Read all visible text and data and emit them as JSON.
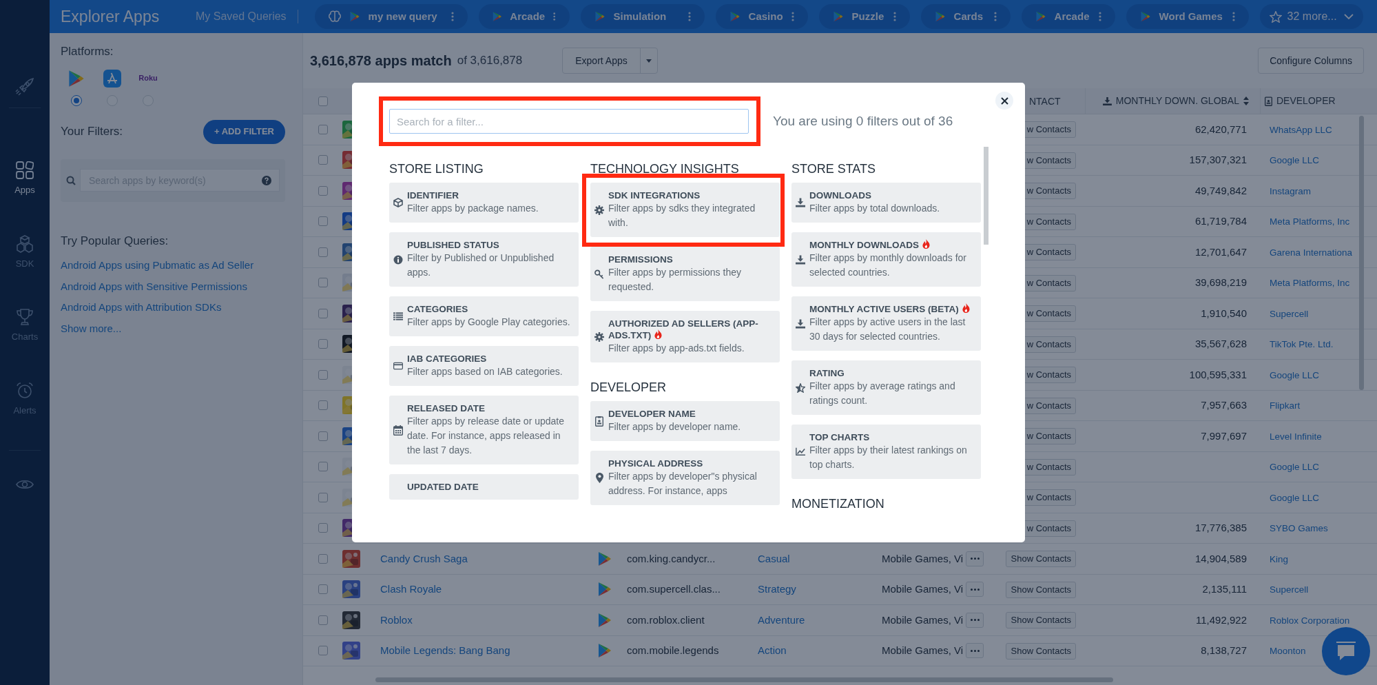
{
  "sidebar": {
    "items": [
      {
        "label": "Apps",
        "selected": true
      },
      {
        "label": "SDK",
        "selected": false
      },
      {
        "label": "Charts",
        "selected": false
      },
      {
        "label": "Alerts",
        "selected": false
      }
    ]
  },
  "top_bar": {
    "title": "Explorer Apps",
    "saved_queries_label": "My Saved Queries",
    "queries": [
      {
        "kind": "custom",
        "label": "my new query"
      },
      {
        "kind": "store",
        "label": "Arcade"
      },
      {
        "kind": "store",
        "label": "Simulation"
      },
      {
        "kind": "store",
        "label": "Casino"
      },
      {
        "kind": "store",
        "label": "Puzzle"
      },
      {
        "kind": "store",
        "label": "Cards"
      },
      {
        "kind": "store",
        "label": "Arcade"
      },
      {
        "kind": "store",
        "label": "Word Games"
      }
    ],
    "more_button": "32 more..."
  },
  "filters_panel": {
    "platforms_label": "Platforms:",
    "platforms": [
      {
        "kind": "google_play",
        "selected": true
      },
      {
        "kind": "app_store",
        "selected": false
      },
      {
        "kind": "roku",
        "label": "Roku",
        "selected": false
      }
    ],
    "your_filters_label": "Your Filters:",
    "add_filter_button": "+ ADD FILTER",
    "search_placeholder": "Search apps by keyword(s)",
    "popular_queries_label": "Try Popular Queries:",
    "popular_queries": [
      "Android Apps using Pubmatic as Ad Seller",
      "Android Apps with Sensitive Permissions",
      "Android Apps with Attribution SDKs"
    ],
    "show_more": "Show more..."
  },
  "results": {
    "count": "3,616,878 apps match",
    "total": "of 3,616,878",
    "export_button": "Export Apps",
    "configure_button": "Configure Columns"
  },
  "table": {
    "select_all_checked": false,
    "columns": [
      {
        "label": "NTACT"
      },
      {
        "label": "MONTHLY DOWN. GLOBAL"
      },
      {
        "label": "DEVELOPER"
      }
    ],
    "rows": [
      {
        "checked": false,
        "contacts": "w Contacts",
        "downloads": "62,420,771",
        "developer": "WhatsApp LLC"
      },
      {
        "checked": false,
        "contacts": "w Contacts",
        "downloads": "157,307,321",
        "developer": "Google LLC"
      },
      {
        "checked": false,
        "contacts": "w Contacts",
        "downloads": "49,749,842",
        "developer": "Instagram"
      },
      {
        "checked": false,
        "contacts": "w Contacts",
        "downloads": "61,719,784",
        "developer": "Meta Platforms, Inc"
      },
      {
        "checked": false,
        "contacts": "w Contacts",
        "downloads": "12,701,647",
        "developer": "Garena Internationa"
      },
      {
        "checked": false,
        "contacts": "w Contacts",
        "downloads": "39,698,219",
        "developer": "Meta Platforms, Inc"
      },
      {
        "checked": false,
        "contacts": "w Contacts",
        "downloads": "1,910,540",
        "developer": "Supercell"
      },
      {
        "checked": false,
        "contacts": "w Contacts",
        "downloads": "35,567,628",
        "developer": "TikTok Pte. Ltd."
      },
      {
        "checked": false,
        "contacts": "w Contacts",
        "downloads": "100,595,331",
        "developer": "Google LLC"
      },
      {
        "checked": false,
        "contacts": "w Contacts",
        "downloads": "7,957,663",
        "developer": "Flipkart"
      },
      {
        "checked": false,
        "contacts": "w Contacts",
        "downloads": "7,997,697",
        "developer": "Level Infinite"
      },
      {
        "checked": false,
        "contacts": "w Contacts",
        "developer": "Google LLC"
      },
      {
        "checked": false,
        "contacts": "w Contacts",
        "developer": "Google LLC"
      },
      {
        "checked": false,
        "contacts": "w Contacts",
        "downloads": "17,776,385",
        "developer": "SYBO Games"
      },
      {
        "checked": false,
        "name": "Candy Crush Saga",
        "package": "com.king.candycr...",
        "category": "Casual",
        "tags": "Mobile Games, Vi",
        "contacts": "Show Contacts",
        "downloads": "14,904,589",
        "developer": "King"
      },
      {
        "checked": false,
        "name": "Clash Royale",
        "package": "com.supercell.clas...",
        "category": "Strategy",
        "tags": "Mobile Games, Vi",
        "contacts": "Show Contacts",
        "downloads": "2,135,111",
        "developer": "Supercell"
      },
      {
        "checked": false,
        "name": "Roblox",
        "package": "com.roblox.client",
        "category": "Adventure",
        "tags": "Mobile Games, Vi",
        "contacts": "Show Contacts",
        "downloads": "11,492,922",
        "developer": "Roblox Corporation"
      },
      {
        "checked": false,
        "name": "Mobile Legends: Bang Bang",
        "package": "com.mobile.legends",
        "category": "Action",
        "tags": "Mobile Games, Vi",
        "contacts": "Show Contacts",
        "downloads": "8,138,727",
        "developer": "Moonton"
      }
    ]
  },
  "modal": {
    "search": {
      "placeholder": "Search for a filter...",
      "highlighted": true
    },
    "usage": "You are using 0 filters out of 36",
    "columns": [
      {
        "sections": [
          {
            "title": "STORE LISTING",
            "cards": [
              {
                "title": "IDENTIFIER",
                "description": "Filter apps by package names.",
                "hot": false,
                "highlighted": false
              },
              {
                "title": "PUBLISHED STATUS",
                "description": "Filter by Published or Unpublished apps.",
                "hot": false,
                "highlighted": false
              },
              {
                "title": "CATEGORIES",
                "description": "Filter apps by Google Play categories.",
                "hot": false,
                "highlighted": false
              },
              {
                "title": "IAB CATEGORIES",
                "description": "Filter apps based on IAB categories.",
                "hot": false,
                "highlighted": false
              },
              {
                "title": "RELEASED DATE",
                "description": "Filter apps by release date or update date. For instance, apps released in the last 7 days.",
                "hot": false,
                "highlighted": false
              },
              {
                "title": "UPDATED DATE",
                "hot": false,
                "highlighted": false
              }
            ]
          }
        ]
      },
      {
        "sections": [
          {
            "title": "TECHNOLOGY INSIGHTS",
            "cards": [
              {
                "title": "SDK INTEGRATIONS",
                "description": "Filter apps by sdks they integrated with.",
                "hot": false,
                "highlighted": true
              },
              {
                "title": "PERMISSIONS",
                "description": "Filter apps by permissions they requested.",
                "hot": false,
                "highlighted": false
              },
              {
                "title": "AUTHORIZED AD SELLERS (APP-ADS.TXT)",
                "description": "Filter apps by app-ads.txt fields.",
                "hot": true,
                "highlighted": false
              }
            ]
          },
          {
            "title": "DEVELOPER",
            "cards": [
              {
                "title": "DEVELOPER NAME",
                "description": "Filter apps by developer name.",
                "hot": false,
                "highlighted": false
              },
              {
                "title": "PHYSICAL ADDRESS",
                "description": "Filter apps by developer\"s physical address. For instance, apps",
                "hot": false,
                "highlighted": false
              }
            ]
          }
        ]
      },
      {
        "sections": [
          {
            "title": "STORE STATS",
            "cards": [
              {
                "title": "DOWNLOADS",
                "description": "Filter apps by total downloads.",
                "hot": false,
                "highlighted": false
              },
              {
                "title": "MONTHLY DOWNLOADS",
                "description": "Filter apps by monthly downloads for selected countries.",
                "hot": true,
                "highlighted": false
              },
              {
                "title": "MONTHLY ACTIVE USERS (BETA)",
                "description": "Filter apps by active users in the last 30 days for selected countries.",
                "hot": true,
                "highlighted": false
              },
              {
                "title": "RATING",
                "description": "Filter apps by average ratings and ratings count.",
                "hot": false,
                "highlighted": false
              },
              {
                "title": "TOP CHARTS",
                "description": "Filter apps by their latest rankings on top charts.",
                "hot": false,
                "highlighted": false
              }
            ]
          },
          {
            "title": "MONETIZATION"
          }
        ]
      }
    ]
  }
}
